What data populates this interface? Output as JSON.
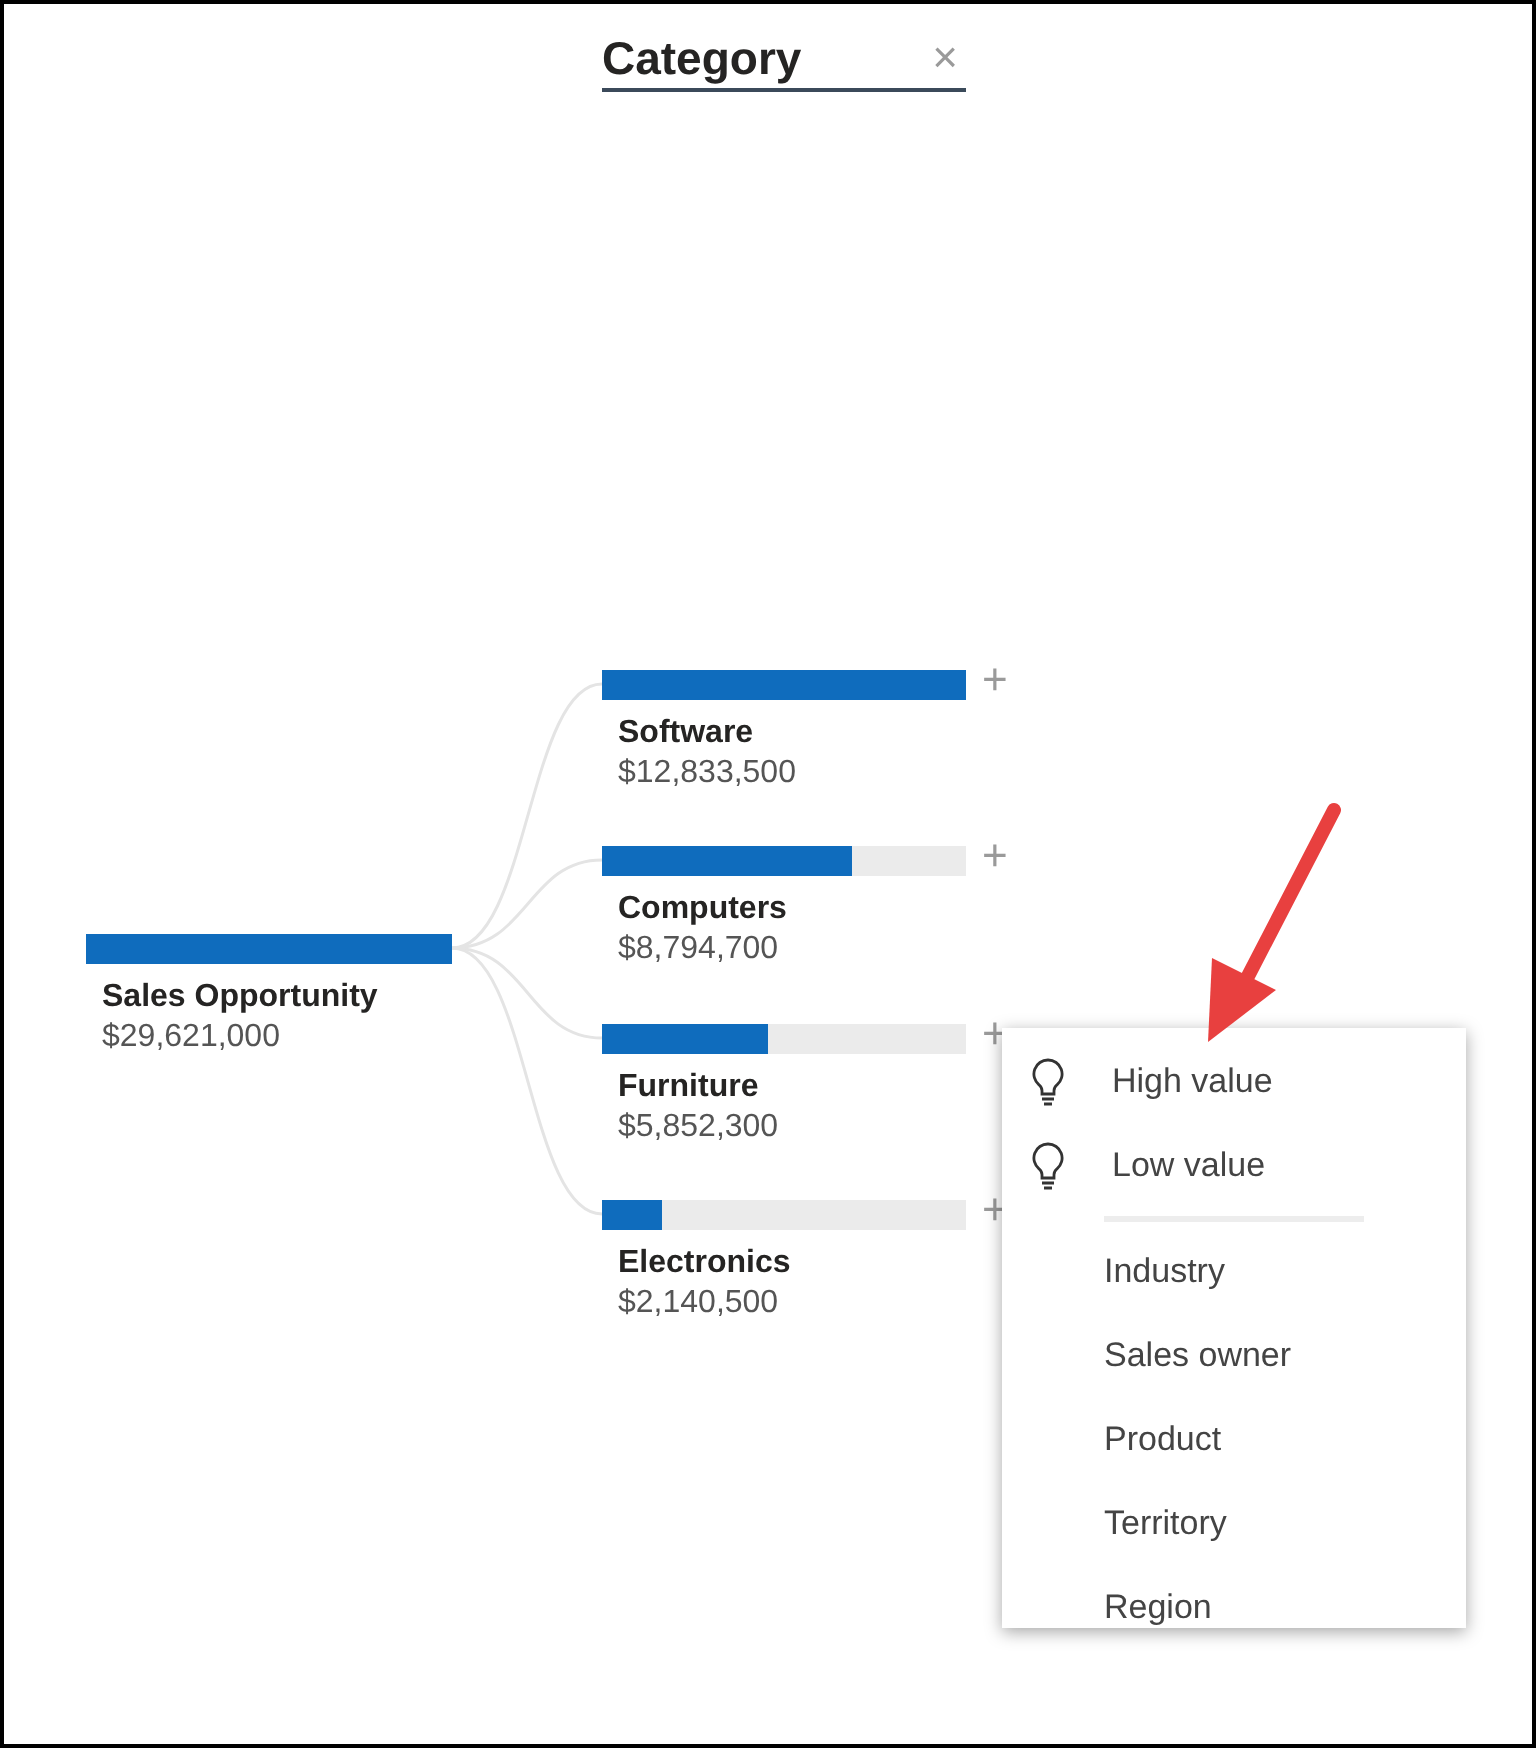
{
  "header": {
    "title": "Category",
    "close": "×"
  },
  "root": {
    "label": "Sales Opportunity",
    "value": "$29,621,000"
  },
  "nodes": [
    {
      "label": "Software",
      "value": "$12,833,500",
      "level": 1,
      "expand": "+"
    },
    {
      "label": "Computers",
      "value": "$8,794,700",
      "level": 0.685,
      "expand": "+"
    },
    {
      "label": "Furniture",
      "value": "$5,852,300",
      "level": 0.456,
      "expand": "+"
    },
    {
      "label": "Electronics",
      "value": "$2,140,500",
      "level": 0.167,
      "expand": "+"
    }
  ],
  "menu": [
    {
      "kind": "insight",
      "label": "High value"
    },
    {
      "kind": "insight",
      "label": "Low value"
    },
    {
      "kind": "separator"
    },
    {
      "kind": "field",
      "label": "Industry"
    },
    {
      "kind": "field",
      "label": "Sales owner"
    },
    {
      "kind": "field",
      "label": "Product"
    },
    {
      "kind": "field",
      "label": "Territory"
    },
    {
      "kind": "field",
      "label": "Region"
    }
  ]
}
